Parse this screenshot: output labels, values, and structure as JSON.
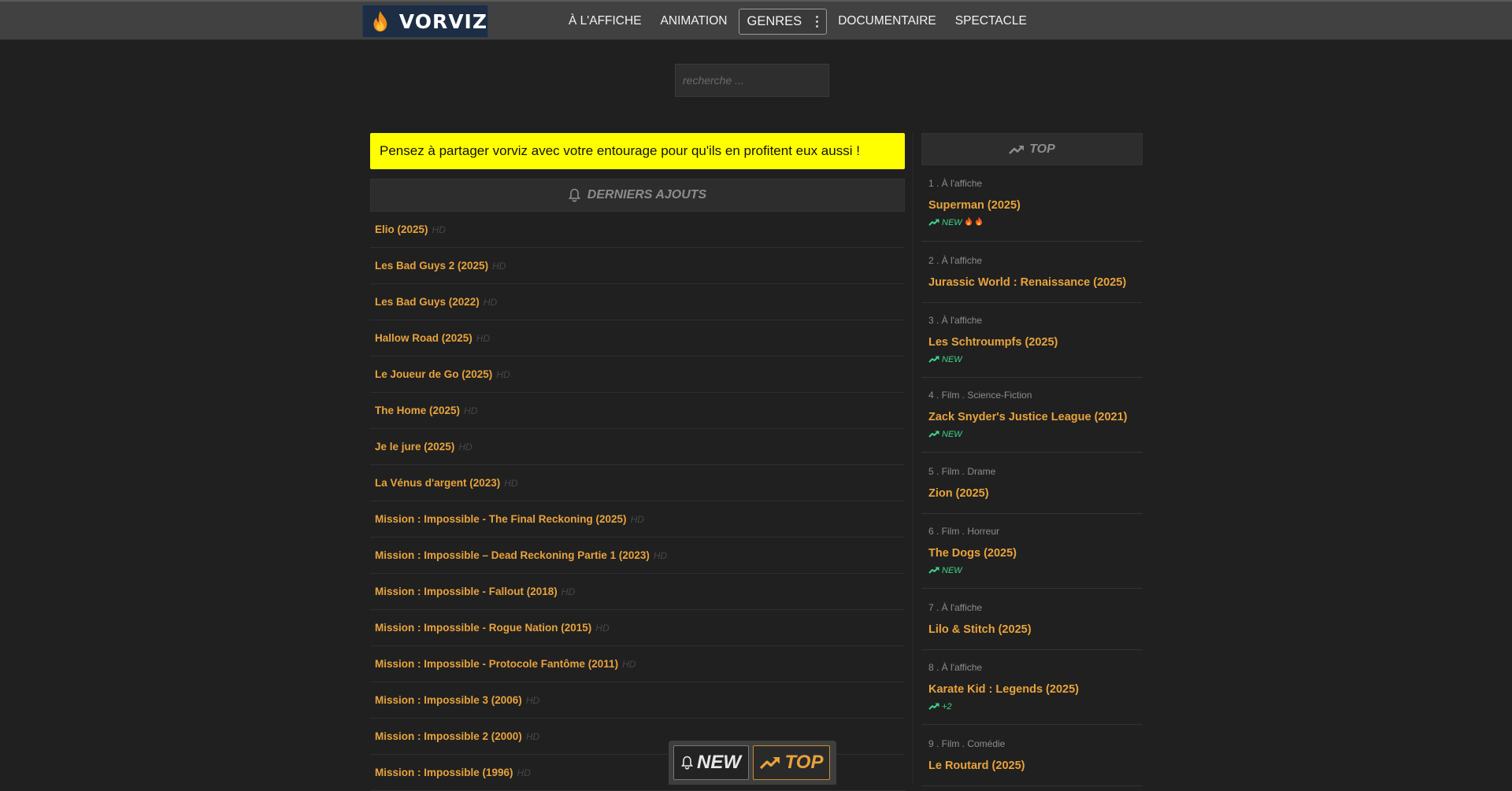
{
  "brand": {
    "name": "VORVIZ",
    "accent_color": "#e8a33c",
    "logo_icon": "flame-icon"
  },
  "nav": {
    "items": [
      "À L'AFFICHE",
      "ANIMATION",
      "GENRES",
      "DOCUMENTAIRE",
      "SPECTACLE"
    ],
    "genres_icon": "kebab-icon"
  },
  "search": {
    "placeholder": "recherche ..."
  },
  "notice": "Pensez à partager vorviz avec votre entourage pour qu'ils en profitent eux aussi !",
  "latest": {
    "title": "DERNIERS AJOUTS",
    "icon": "bell-icon",
    "badge": "HD",
    "items": [
      "Elio (2025)",
      "Les Bad Guys 2 (2025)",
      "Les Bad Guys (2022)",
      "Hallow Road (2025)",
      "Le Joueur de Go (2025)",
      "The Home (2025)",
      "Je le jure (2025)",
      "La Vénus d'argent (2023)",
      "Mission : Impossible - The Final Reckoning (2025)",
      "Mission : Impossible – Dead Reckoning Partie 1 (2023)",
      "Mission : Impossible - Fallout (2018)",
      "Mission : Impossible - Rogue Nation (2015)",
      "Mission : Impossible - Protocole Fantôme (2011)",
      "Mission : Impossible 3 (2006)",
      "Mission : Impossible 2 (2000)",
      "Mission : Impossible (1996)"
    ]
  },
  "top": {
    "title": "TOP",
    "icon": "trending-up-icon",
    "trend_color": "#3fd38a",
    "items": [
      {
        "meta": "1 . À l'affiche",
        "title": "Superman (2025)",
        "trend": "NEW",
        "fire": 2
      },
      {
        "meta": "2 . À l'affiche",
        "title": "Jurassic World : Renaissance (2025)",
        "trend": "",
        "fire": 0
      },
      {
        "meta": "3 . À l'affiche",
        "title": "Les Schtroumpfs (2025)",
        "trend": "NEW",
        "fire": 0
      },
      {
        "meta": "4 . Film . Science-Fiction",
        "title": "Zack Snyder's Justice League (2021)",
        "trend": "NEW",
        "fire": 0
      },
      {
        "meta": "5 . Film . Drame",
        "title": "Zion (2025)",
        "trend": "",
        "fire": 0
      },
      {
        "meta": "6 . Film . Horreur",
        "title": "The Dogs (2025)",
        "trend": "NEW",
        "fire": 0
      },
      {
        "meta": "7 . À l'affiche",
        "title": "Lilo & Stitch (2025)",
        "trend": "",
        "fire": 0
      },
      {
        "meta": "8 . À l'affiche",
        "title": "Karate Kid : Legends (2025)",
        "trend": "+2",
        "fire": 0
      },
      {
        "meta": "9 . Film . Comédie",
        "title": "Le Routard (2025)",
        "trend": "",
        "fire": 0
      }
    ]
  },
  "switcher": {
    "new_label": "NEW",
    "top_label": "TOP"
  }
}
